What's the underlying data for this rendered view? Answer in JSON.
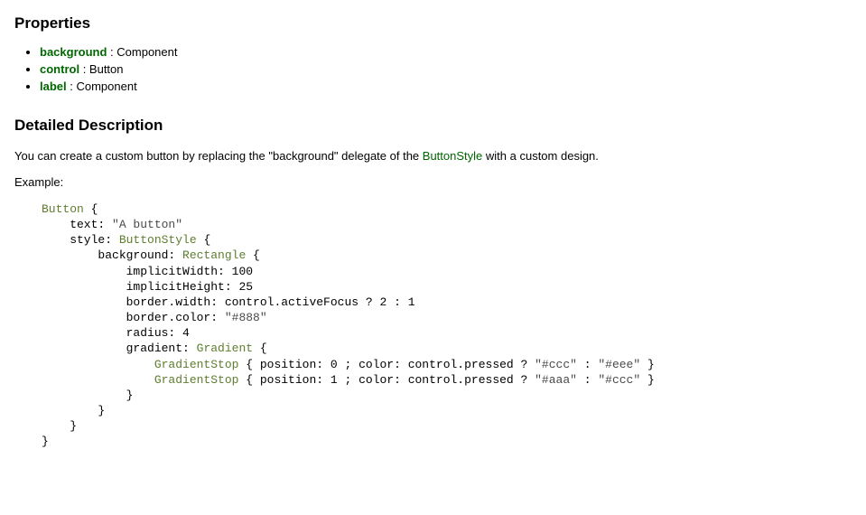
{
  "sections": {
    "properties_heading": "Properties",
    "detailed_heading": "Detailed Description"
  },
  "properties": [
    {
      "name": "background",
      "type": "Component"
    },
    {
      "name": "control",
      "type": "Button"
    },
    {
      "name": "label",
      "type": "Component"
    }
  ],
  "desc_parts": {
    "before_link": "You can create a custom button by replacing the \"background\" delegate of the ",
    "link_text": "ButtonStyle",
    "after_link": " with a custom design."
  },
  "example_label": "Example:",
  "code": {
    "t_button": "Button",
    "l_text_prefix": "    text: ",
    "l_text_str": "\"A button\"",
    "l_style_prefix": "    style: ",
    "t_buttonstyle": "ButtonStyle",
    "l_bg_prefix": "        background: ",
    "t_rectangle": "Rectangle",
    "l_implw_prefix": "            implicitWidth: ",
    "l_implw_val": "100",
    "l_implh_prefix": "            implicitHeight: ",
    "l_implh_val": "25",
    "l_bw_prefix": "            border.width: control.activeFocus ? ",
    "l_bw_v1": "2",
    "l_bw_mid": " : ",
    "l_bw_v2": "1",
    "l_bc_prefix": "            border.color: ",
    "l_bc_str": "\"#888\"",
    "l_radius_prefix": "            radius: ",
    "l_radius_val": "4",
    "l_grad_prefix": "            gradient: ",
    "t_gradient": "Gradient",
    "l_gs1_prefix": "                ",
    "t_gradientstop": "GradientStop",
    "l_gs1_mid1": " { position: ",
    "l_gs1_pos": "0",
    "l_gs1_mid2": " ; color: control.pressed ? ",
    "l_gs1_c1": "\"#ccc\"",
    "l_gs1_mid3": " : ",
    "l_gs1_c2": "\"#eee\"",
    "l_gs1_end": " }",
    "l_gs2_pos": "1",
    "l_gs2_c1": "\"#aaa\"",
    "l_gs2_c2": "\"#ccc\"",
    "close1": "            }",
    "close2": "        }",
    "close3": "    }",
    "close4": "}"
  }
}
